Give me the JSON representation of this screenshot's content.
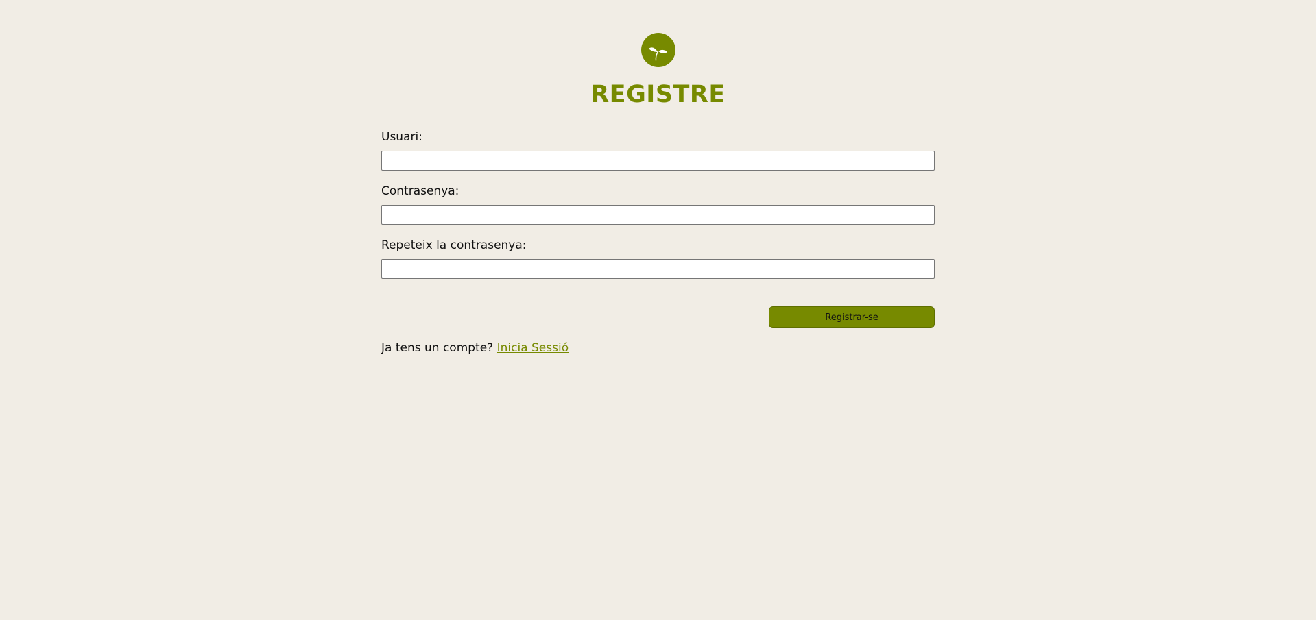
{
  "page": {
    "title": "REGISTRE",
    "background_color": "#f1ede5",
    "accent_color": "#778a00"
  },
  "logo": {
    "icon": "sprout-icon"
  },
  "form": {
    "username": {
      "label": "Usuari:",
      "value": ""
    },
    "password": {
      "label": "Contrasenya:",
      "value": ""
    },
    "repeat_password": {
      "label": "Repeteix la contrasenya:",
      "value": ""
    },
    "submit_label": "Registrar-se"
  },
  "footer": {
    "question": "Ja tens un compte?",
    "link_label": "Inicia Sessió"
  }
}
